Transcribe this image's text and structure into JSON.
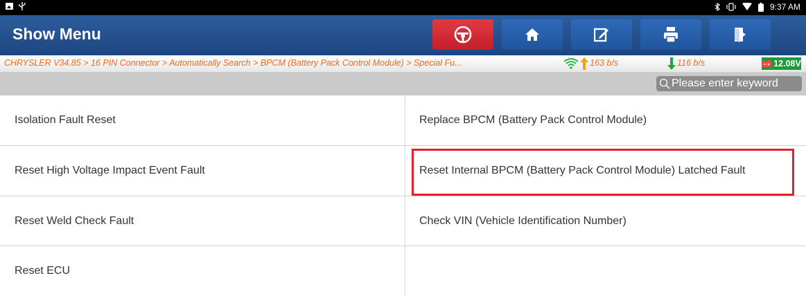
{
  "status_bar": {
    "time": "9:37 AM"
  },
  "header": {
    "title": "Show Menu",
    "toolbar": [
      {
        "name": "steering-wheel-icon",
        "color": "red"
      },
      {
        "name": "home-icon",
        "color": "blue"
      },
      {
        "name": "edit-report-icon",
        "color": "blue"
      },
      {
        "name": "print-icon",
        "color": "blue"
      },
      {
        "name": "exit-icon",
        "color": "blue"
      }
    ]
  },
  "breadcrumb": {
    "path": "CHRYSLER V34.85 > 16 PIN Connector > Automatically Search > BPCM (Battery Pack Control Module) > Special Fu...",
    "upload_speed": "163 b/s",
    "download_speed": "116 b/s",
    "voltage": "12.08V"
  },
  "search": {
    "placeholder": "Please enter keyword"
  },
  "menu": {
    "items": [
      "Isolation Fault Reset",
      "Replace BPCM (Battery Pack Control Module)",
      "Reset High Voltage Impact Event Fault",
      "Reset Internal BPCM (Battery Pack Control Module) Latched Fault",
      "Reset Weld Check Fault",
      "Check VIN (Vehicle Identification Number)",
      "Reset ECU",
      ""
    ],
    "highlighted_index": 3
  },
  "colors": {
    "header": "#1f4e8c",
    "toolbar_blue": "#2a64b0",
    "toolbar_red": "#d9303a",
    "breadcrumb_text": "#f06a1a",
    "upload_arrow": "#f5a300",
    "download_arrow": "#19a83a",
    "voltage_badge": "#1c9a3c",
    "highlight_border": "#e3202b"
  }
}
